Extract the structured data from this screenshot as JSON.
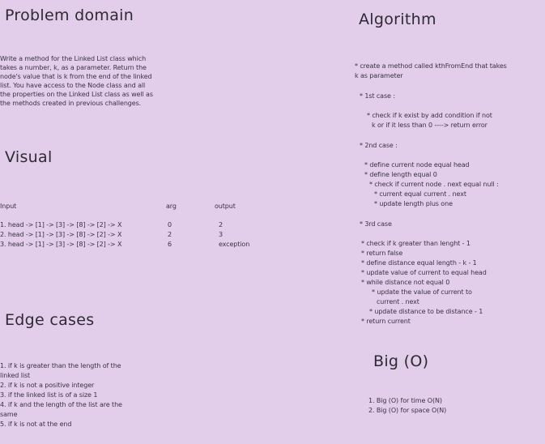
{
  "problem": {
    "title": "Problem domain",
    "lines": [
      "Write a method for the Linked List class which",
      "takes a number, k, as a parameter. Return the",
      "node's value that is k from the end of the linked",
      "list. You have access to the Node class and all",
      "the properties on the Linked List class as well as",
      "the methods created in previous challenges."
    ]
  },
  "visual": {
    "title": "Visual",
    "headers": {
      "input": "Input",
      "arg": "arg",
      "output": "output"
    },
    "rows": [
      {
        "input": "1. head -> [1] -> [3] -> [8] -> [2] -> X",
        "arg": "0",
        "output": "2"
      },
      {
        "input": "2. head -> [1] -> [3] -> [8] -> [2] -> X",
        "arg": "2",
        "output": "3"
      },
      {
        "input": "3. head -> [1] -> [3] -> [8] -> [2] -> X",
        "arg": "6",
        "output": "exception"
      }
    ]
  },
  "edge": {
    "title": "Edge cases",
    "lines": [
      "1. if k is greater than the length of the",
      "linked list",
      "2. if k is not a positive integer",
      "3. if the linked list is of a size 1",
      "4. if k and the length of the list are the",
      "same",
      "5. if k is not at the end"
    ]
  },
  "algorithm": {
    "title": "Algorithm",
    "lines": [
      "* create a method called kthFromEnd that takes",
      "k as parameter",
      "* 1st case :",
      "* check if k exist by add condition if not",
      "k or if it less than 0 ----> return error",
      "* 2nd case :",
      "* define current node equal head",
      "* define length equal 0",
      "* check if current node . next equal null :",
      "* current equal current . next",
      "* update length plus one",
      "* 3rd case",
      "* check if k greater than lenght - 1",
      "* return false",
      "* define distance equal length - k - 1",
      "* update value of current to equal head",
      "* while distance not equal 0",
      "* update the value of current to",
      "current . next",
      "* update distance to be distance - 1",
      "* return current"
    ]
  },
  "bigo": {
    "title": "Big (O)",
    "lines": [
      "1. Big (O) for time O(N)",
      "2. Big (O) for space O(N)"
    ]
  }
}
